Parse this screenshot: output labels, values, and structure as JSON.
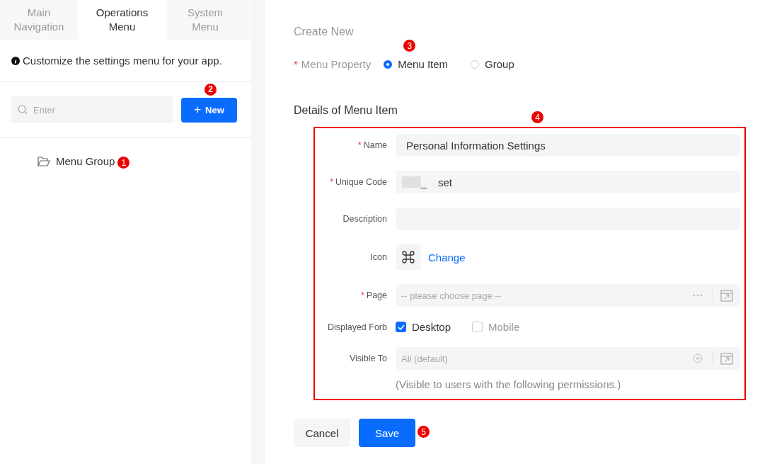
{
  "sidebar": {
    "tabs": [
      {
        "label": "Main Navigation",
        "selected": false
      },
      {
        "label": "Operations Menu",
        "selected": true
      },
      {
        "label": "System Menu",
        "selected": false
      }
    ],
    "info": "Customize the settings menu for your app.",
    "search": {
      "placeholder": "Enter"
    },
    "new_button": {
      "label": "New",
      "icon": "+",
      "callout": "2"
    },
    "tree": [
      {
        "label": "Menu Group",
        "callout": "1"
      }
    ]
  },
  "form": {
    "title": "Create New",
    "property": {
      "label": "Menu Property",
      "required_mark": "*",
      "callout": "3",
      "options": [
        {
          "label": "Menu Item",
          "selected": true
        },
        {
          "label": "Group",
          "selected": false
        }
      ]
    },
    "details_title": "Details of Menu Item",
    "details_callout": "4",
    "fields": [
      {
        "kind": "text",
        "label": "Name",
        "required_mark": "*",
        "value": "Personal Information Settings"
      },
      {
        "kind": "code",
        "label": "Unique Code",
        "required_mark": "*",
        "prefix": "_",
        "value": "set"
      },
      {
        "kind": "text",
        "label": "Description"
      },
      {
        "kind": "icon",
        "label": "Icon",
        "link": "Change"
      },
      {
        "kind": "select_more",
        "label": "Page",
        "required_mark": "*",
        "placeholder": "-- please choose page --"
      },
      {
        "kind": "checks",
        "label": "Displayed Forb",
        "options": [
          {
            "label": "Desktop",
            "checked": true
          },
          {
            "label": "Mobile",
            "checked": false
          }
        ]
      },
      {
        "kind": "select_add",
        "label": "Visible To",
        "placeholder": "All (default)",
        "hint": "(Visible to users with the following permissions.)"
      }
    ],
    "buttons": [
      {
        "label": "Cancel",
        "kind": "secondary"
      },
      {
        "label": "Save",
        "kind": "primary",
        "callout": "5"
      }
    ]
  }
}
